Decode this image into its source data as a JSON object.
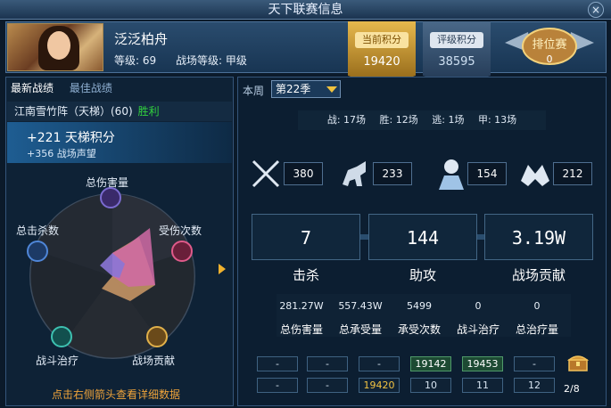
{
  "window": {
    "title": "天下联赛信息",
    "close_label": "×"
  },
  "player": {
    "name": "泛泛柏舟",
    "level_label": "等级: 69",
    "battle_level_label": "战场等级: 甲级"
  },
  "banners": {
    "current_points": {
      "label": "当前积分",
      "value": "19420"
    },
    "rating_points": {
      "label": "评级积分",
      "value": "38595"
    },
    "ranking": {
      "label": "排位赛",
      "value": "0"
    }
  },
  "left": {
    "tabs": [
      "最新战绩",
      "最佳战绩"
    ],
    "match": {
      "name": "江南雪竹阵（天梯）(60)",
      "result": "胜利"
    },
    "ladder_gain": "+221 天梯积分",
    "prestige_gain": "+356 战场声望",
    "radar_labels": {
      "top": "总伤害量",
      "left": "总击杀数",
      "right": "受伤次数",
      "bottom_left": "战斗治疗",
      "bottom_right": "战场贡献"
    },
    "hint": "点击右侧箭头查看详细数据"
  },
  "right": {
    "week_label": "本周",
    "season_value": "第22季",
    "record": {
      "battles": "战: 17场",
      "wins": "胜: 12场",
      "escapes": "逃: 1场",
      "grade_a": "甲: 13场"
    },
    "icons": [
      {
        "icon": "crossed-swords-icon",
        "value": "380"
      },
      {
        "icon": "horse-icon",
        "value": "233"
      },
      {
        "icon": "warrior-icon",
        "value": "154"
      },
      {
        "icon": "handshake-icon",
        "value": "212"
      }
    ],
    "stats": [
      {
        "value": "7",
        "label": "击杀"
      },
      {
        "value": "144",
        "label": "助攻"
      },
      {
        "value": "3.19W",
        "label": "战场贡献"
      }
    ],
    "small_stats": [
      {
        "value": "281.27W",
        "label": "总伤害量"
      },
      {
        "value": "557.43W",
        "label": "总承受量"
      },
      {
        "value": "5499",
        "label": "承受次数"
      },
      {
        "value": "0",
        "label": "战斗治疗"
      },
      {
        "value": "0",
        "label": "总治疗量"
      }
    ],
    "grid_row1": [
      "-",
      "-",
      "-",
      "19142",
      "19453",
      "-"
    ],
    "grid_row2": [
      "-",
      "-",
      "19420",
      "10",
      "11",
      "12"
    ],
    "chest_count": "2/8"
  }
}
